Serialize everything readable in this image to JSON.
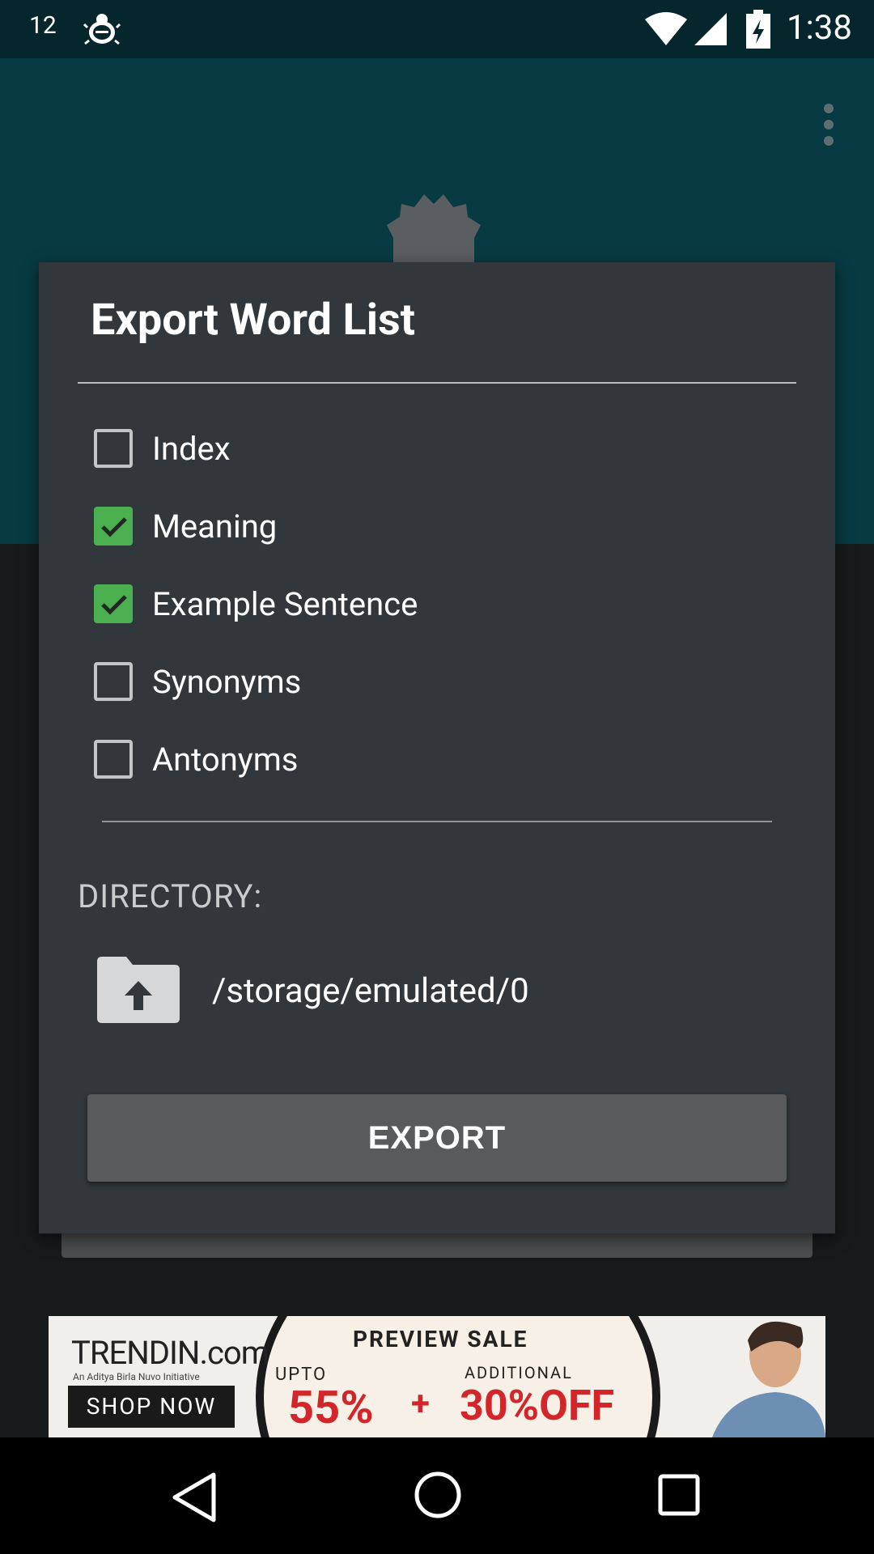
{
  "status_bar": {
    "notification_count": "12",
    "time": "1:38"
  },
  "dialog": {
    "title": "Export Word List",
    "options": [
      {
        "label": "Index",
        "checked": false
      },
      {
        "label": "Meaning",
        "checked": true
      },
      {
        "label": "Example Sentence",
        "checked": true
      },
      {
        "label": "Synonyms",
        "checked": false
      },
      {
        "label": "Antonyms",
        "checked": false
      }
    ],
    "directory_label": "DIRECTORY:",
    "directory_path": "/storage/emulated/0",
    "export_label": "EXPORT"
  },
  "ad": {
    "logo": "TRENDIN.com",
    "tagline": "An Aditya Birla Nuvo Initiative",
    "shop_now": "SHOP NOW",
    "headline": "PREVIEW SALE",
    "upto": "UPTO",
    "additional": "ADDITIONAL",
    "discount_primary": "55%",
    "plus": "+",
    "discount_secondary": "30%OFF"
  },
  "colors": {
    "status_bar": "#04262c",
    "app_bar": "#073a42",
    "dialog_bg": "#31373a",
    "checkbox_checked": "#4caf50",
    "button_bg": "#595a5c"
  }
}
